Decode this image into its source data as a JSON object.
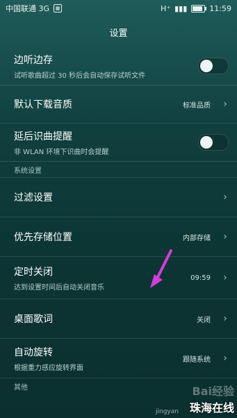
{
  "status_bar": {
    "carrier": "中国联通 3G",
    "network": "H⁺",
    "time": "11:59",
    "battery_level": 0.9
  },
  "header": {
    "title": "设置"
  },
  "settings": {
    "trial_listen": {
      "label": "边听边存",
      "sub": "试听歌曲超过 30 秒后会自动保存试听文件"
    },
    "default_download_quality": {
      "label": "默认下载音质",
      "value": "标准品质"
    },
    "delayed_recognition": {
      "label": "延后识曲提醒",
      "sub": "非 WLAN 环境下识曲时会提醒"
    },
    "system_section": "系统设置",
    "filter": {
      "label": "过滤设置"
    },
    "storage": {
      "label": "优先存储位置",
      "value": "内部存储"
    },
    "timer_off": {
      "label": "定时关闭",
      "sub": "达到设置时间后自动关闭音乐",
      "value": "09:59"
    },
    "desktop_lyrics": {
      "label": "桌面歌词",
      "value": "关闭"
    },
    "auto_rotate": {
      "label": "自动旋转",
      "sub": "根据重力感应旋转界面",
      "value": "跟随系统"
    },
    "other_section": "其他"
  },
  "watermark": {
    "logo": "Bai经验",
    "sub": "jingyan",
    "brand": "珠海在线"
  },
  "colors": {
    "annotation_arrow": "#d63cd8"
  },
  "icons": [
    "sim-icon",
    "signal-icon",
    "battery-icon",
    "chevron-right-icon",
    "toggle-switch"
  ]
}
